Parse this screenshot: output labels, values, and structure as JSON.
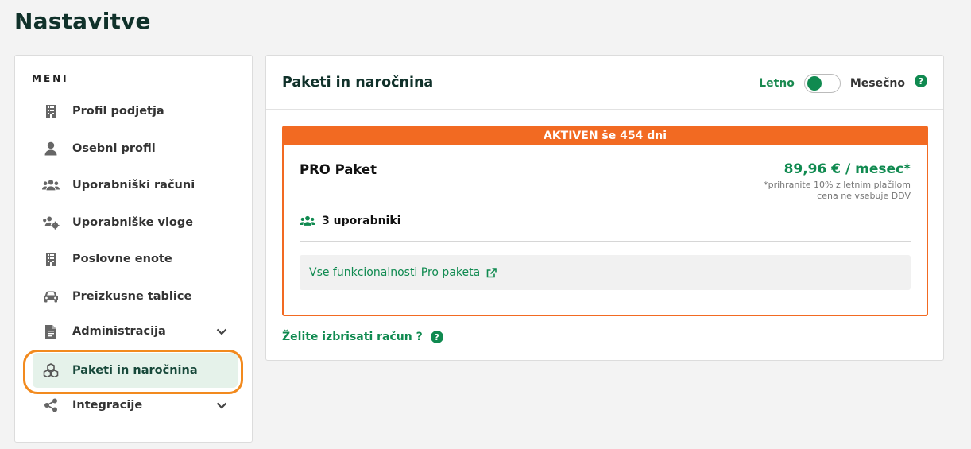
{
  "page": {
    "title": "Nastavitve"
  },
  "sidebar": {
    "menu_label": "MENI",
    "items": [
      {
        "label": "Profil podjetja",
        "icon": "building-icon"
      },
      {
        "label": "Osebni profil",
        "icon": "user-icon"
      },
      {
        "label": "Uporabniški računi",
        "icon": "users-icon"
      },
      {
        "label": "Uporabniške vloge",
        "icon": "users-cog-icon"
      },
      {
        "label": "Poslovne enote",
        "icon": "building-icon"
      },
      {
        "label": "Preizkusne tablice",
        "icon": "car-icon"
      },
      {
        "label": "Administracija",
        "icon": "document-icon",
        "expandable": true
      },
      {
        "label": "Paketi in naročnina",
        "icon": "cubes-icon",
        "active": true
      },
      {
        "label": "Integracije",
        "icon": "share-icon",
        "expandable": true
      }
    ]
  },
  "main": {
    "title": "Paketi in naročnina",
    "billing_toggle": {
      "left_label": "Letno",
      "right_label": "Mesečno",
      "selected": "Letno"
    },
    "help_glyph": "?",
    "plan": {
      "banner": "AKTIVEN še  454 dni",
      "name": "PRO Paket",
      "price": "89,96 € / mesec*",
      "note_savings": "*prihranite 10% z letnim plačilom",
      "note_vat": "cena ne vsebuje DDV",
      "users": "3 uporabniki",
      "features_link": "Vse funkcionalnosti Pro paketa"
    },
    "delete_account": "Želite izbrisati račun ?"
  },
  "colors": {
    "accent_green": "#108a50",
    "banner_orange": "#f26a22",
    "highlight_orange": "#f28a1e",
    "active_bg": "#e5f2ea"
  }
}
